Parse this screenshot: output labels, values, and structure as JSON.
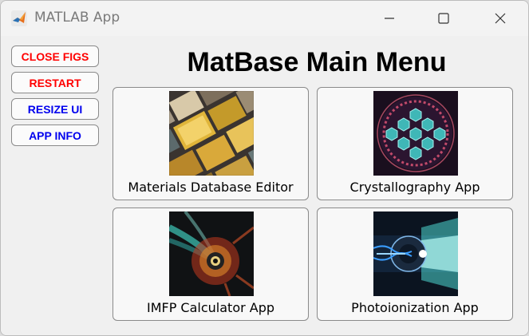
{
  "window": {
    "title": "MATLAB App"
  },
  "sidebar": {
    "buttons": [
      {
        "label": "CLOSE FIGS",
        "color": "#ff0000"
      },
      {
        "label": "RESTART",
        "color": "#ff0000"
      },
      {
        "label": "RESIZE UI",
        "color": "#0000ee"
      },
      {
        "label": "APP INFO",
        "color": "#0000ee"
      }
    ]
  },
  "main": {
    "title": "MatBase Main Menu",
    "apps": [
      {
        "label": "Materials Database Editor",
        "icon": "materials-chips-image"
      },
      {
        "label": "Crystallography App",
        "icon": "crystal-lattice-image"
      },
      {
        "label": "IMFP Calculator App",
        "icon": "imfp-particle-spiral-image"
      },
      {
        "label": "Photoionization App",
        "icon": "photoionization-beam-image"
      }
    ]
  }
}
